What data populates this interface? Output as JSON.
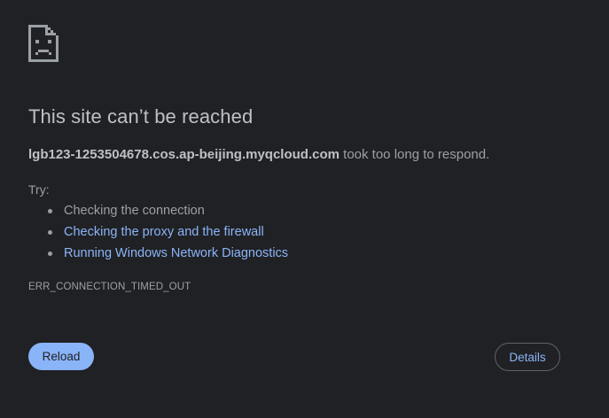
{
  "error": {
    "title": "This site can’t be reached",
    "host": "lgb123-1253504678.cos.ap-beijing.myqcloud.com",
    "message_suffix": " took too long to respond.",
    "try_label": "Try:",
    "suggestions": [
      {
        "label": "Checking the connection",
        "link": false
      },
      {
        "label": "Checking the proxy and the firewall",
        "link": true
      },
      {
        "label": "Running Windows Network Diagnostics",
        "link": true
      }
    ],
    "code": "ERR_CONNECTION_TIMED_OUT"
  },
  "buttons": {
    "reload_label": "Reload",
    "details_label": "Details"
  },
  "icon": "sad-page-icon",
  "colors": {
    "background": "#202124",
    "title": "#bdc1c6",
    "text": "#9aa0a6",
    "link": "#8ab4f8",
    "primary_button": "#8ab4f8",
    "outline": "#5f6368"
  }
}
